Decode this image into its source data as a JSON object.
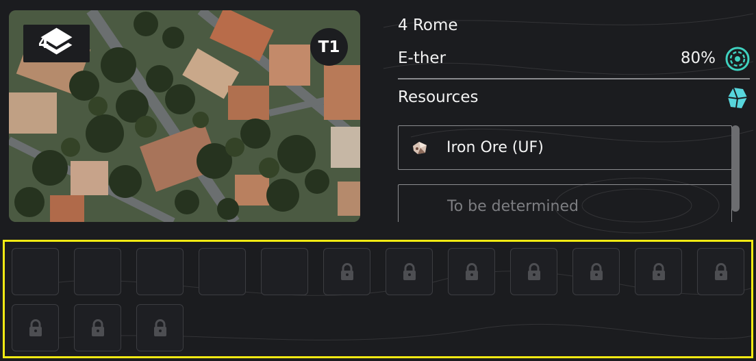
{
  "map_tile": {
    "layer_count": "4",
    "tier": "T1"
  },
  "location": {
    "title": "4 Rome",
    "ether_label": "E-ther",
    "ether_value": "80%",
    "resources_label": "Resources"
  },
  "resources": [
    {
      "name": "Iron Ore (UF)",
      "icon": "iron-ore-icon"
    },
    {
      "name": "To be determined",
      "icon": ""
    }
  ],
  "slots": {
    "open_count": 5,
    "locked_count": 10,
    "per_row": 12,
    "highlight_color": "#f3ea13"
  },
  "colors": {
    "background": "#1b1c1f",
    "ether_icon": "#3fd2c0",
    "resources_icon": "#57d6dc"
  }
}
